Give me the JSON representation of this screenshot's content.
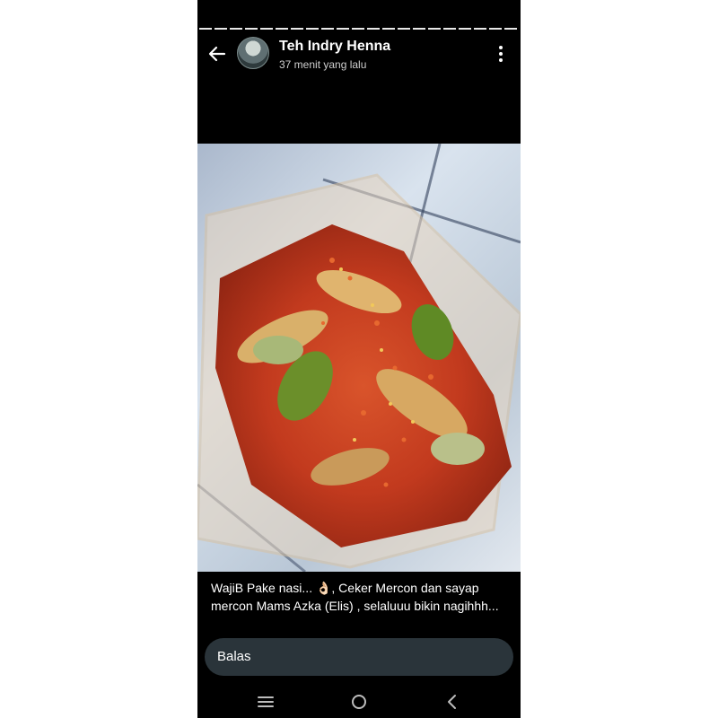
{
  "story": {
    "author_name": "Teh Indry Henna",
    "timestamp": "37 menit yang lalu",
    "caption": "WajiB Pake nasi... 👌🏻, Ceker Mercon dan sayap mercon Mams Azka (Elis) , selaluuu bikin nagihhh...",
    "photo_subject": "ceker and sayap mercon in a plastic container"
  },
  "reply": {
    "placeholder": "Balas"
  },
  "icons": {
    "back": "arrow-left-icon",
    "more": "more-vertical-icon",
    "nav_recents": "menu-lines-icon",
    "nav_home": "circle-home-icon",
    "nav_back": "chevron-left-icon"
  },
  "colors": {
    "background": "#000000",
    "reply_bar": "#2a343a",
    "text": "#ffffff"
  }
}
